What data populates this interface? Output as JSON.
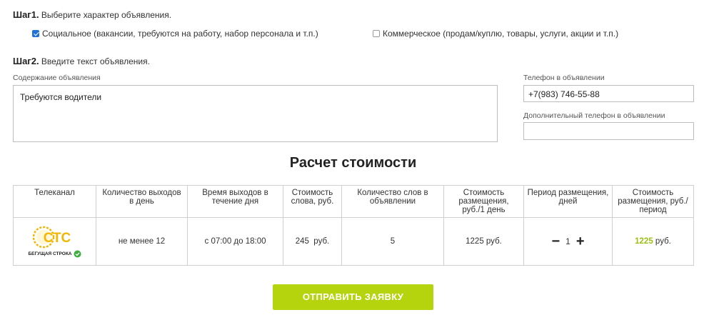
{
  "step1": {
    "title": "Шаг1.",
    "text": "Выберите характер объявления.",
    "options": [
      {
        "label": "Социальное (вакансии, требуются на работу, набор персонала и т.п.)",
        "checked": true
      },
      {
        "label": "Коммерческое (продам/куплю, товары, услуги, акции и т.п.)",
        "checked": false
      }
    ]
  },
  "step2": {
    "title": "Шаг2.",
    "text": "Введите текст объявления.",
    "content_label": "Содержание объявления",
    "content_value": "Требуются водители",
    "phone_label": "Телефон в объявлении",
    "phone_value": "+7(983) 746-55-88",
    "phone2_label": "Дополнительный телефон в объявлении",
    "phone2_value": ""
  },
  "calc": {
    "title": "Расчет стоимости",
    "headers": [
      "Телеканал",
      "Количество выходов в день",
      "Время выходов в течение дня",
      "Стоимость слова, руб.",
      "Количество слов в объявлении",
      "Стоимость размещения, руб./1 день",
      "Период размещения, дней",
      "Стоимость размещения, руб./период"
    ],
    "row": {
      "channel_logo_text": "СТС",
      "channel_caption": "БЕГУЩАЯ СТРОКА",
      "outputs": "не менее 12",
      "time": "с 07:00 до 18:00",
      "word_price": "245  руб.",
      "word_count": "5",
      "day_price": "1225 руб.",
      "period_minus": "−",
      "period_value": "1",
      "period_plus": "+",
      "total_value": "1225",
      "total_unit": " руб."
    }
  },
  "submit": {
    "label": "ОТПРАВИТЬ ЗАЯВКУ"
  },
  "colors": {
    "accent": "#b6d40d",
    "checkbox": "#1f73d8",
    "logo": "#f2b705"
  }
}
